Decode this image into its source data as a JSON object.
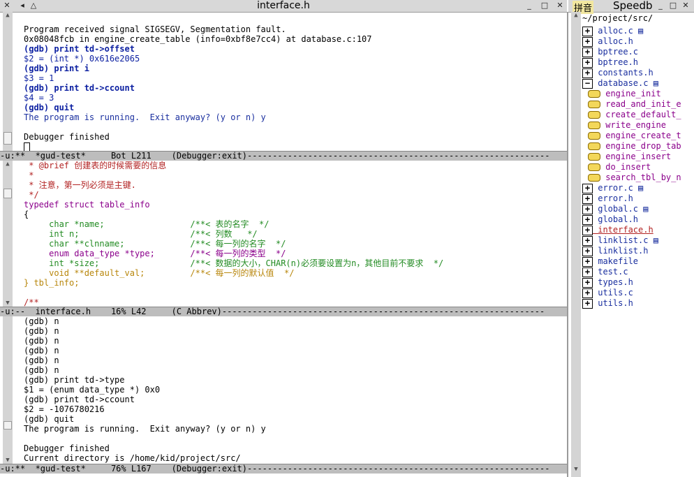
{
  "window": {
    "title": "interface.h"
  },
  "side_window": {
    "title": "Speedb",
    "ime_label": "拼音"
  },
  "gdb_top": {
    "lines": [
      "Program received signal SIGSEGV, Segmentation fault.",
      "0x08048fcb in engine_create_table (info=0xbf8e7cc4) at database.c:107",
      "(gdb) print td->offset",
      "$2 = (int *) 0x616e2065",
      "(gdb) print i",
      "$3 = 1",
      "(gdb) print td->ccount",
      "$4 = 3",
      "(gdb) quit",
      "The program is running.  Exit anyway? (y or n) y",
      "",
      "Debugger finished"
    ],
    "modeline": "-u:**  *gud-test*     Bot L211    (Debugger:exit)------------------------------------------------------------"
  },
  "code_pane": {
    "lines": [
      " * @brief 创建表的时候需要的信息",
      " *",
      " * 注意，第一列必须是主键.",
      " */",
      "typedef struct table_info",
      "{",
      "     char *name;                 /**< 表的名字  */",
      "     int n;                      /**< 列数   */",
      "     char **clnname;             /**< 每一列的名字  */",
      "     enum data_type *type;       /**< 每一列的类型  */",
      "     int *size;                  /**< 数据的大小，CHAR(n)必须要设置为n，其他目前不要求  */",
      "     void **default_val;         /**< 每一列的默认值  */",
      "} tbl_info;",
      "",
      "/**"
    ],
    "modeline": "-u:--  interface.h    16% L42     (C Abbrev)----------------------------------------------------------------"
  },
  "gdb_bottom": {
    "lines": [
      "(gdb) n",
      "(gdb) n",
      "(gdb) n",
      "(gdb) n",
      "(gdb) n",
      "(gdb) n",
      "(gdb) print td->type",
      "$1 = (enum data_type *) 0x0",
      "(gdb) print td->ccount",
      "$2 = -1076780216",
      "(gdb) quit",
      "The program is running.  Exit anyway? (y or n) y",
      "",
      "Debugger finished",
      "Current directory is /home/kid/project/src/"
    ],
    "modeline": "-u:**  *gud-test*     76% L167    (Debugger:exit)------------------------------------------------------------"
  },
  "speedbar": {
    "path": "~/project/src/",
    "items": [
      {
        "kind": "file",
        "label": "alloc.c",
        "obj": true
      },
      {
        "kind": "file",
        "label": "alloc.h",
        "obj": false
      },
      {
        "kind": "file",
        "label": "bptree.c",
        "obj": false
      },
      {
        "kind": "file",
        "label": "bptree.h",
        "obj": false
      },
      {
        "kind": "file",
        "label": "constants.h",
        "obj": false
      },
      {
        "kind": "file-open",
        "label": "database.c",
        "obj": true
      },
      {
        "kind": "tag",
        "label": "engine_init"
      },
      {
        "kind": "tag",
        "label": "read_and_init_e"
      },
      {
        "kind": "tag",
        "label": "create_default_"
      },
      {
        "kind": "tag",
        "label": "write_engine"
      },
      {
        "kind": "tag",
        "label": "engine_create_t"
      },
      {
        "kind": "tag",
        "label": "engine_drop_tab"
      },
      {
        "kind": "tag",
        "label": "engine_insert"
      },
      {
        "kind": "tag",
        "label": "do_insert"
      },
      {
        "kind": "tag",
        "label": "search_tbl_by_n"
      },
      {
        "kind": "file",
        "label": "error.c",
        "obj": true
      },
      {
        "kind": "file",
        "label": "error.h",
        "obj": false
      },
      {
        "kind": "file",
        "label": "global.c",
        "obj": true
      },
      {
        "kind": "file",
        "label": "global.h",
        "obj": false
      },
      {
        "kind": "file-current",
        "label": "interface.h",
        "obj": false
      },
      {
        "kind": "file",
        "label": "linklist.c",
        "obj": true
      },
      {
        "kind": "file",
        "label": "linklist.h",
        "obj": false
      },
      {
        "kind": "file",
        "label": "makefile",
        "obj": false
      },
      {
        "kind": "file",
        "label": "test.c",
        "obj": false
      },
      {
        "kind": "file",
        "label": "types.h",
        "obj": false
      },
      {
        "kind": "file",
        "label": "utils.c",
        "obj": false
      },
      {
        "kind": "file",
        "label": "utils.h",
        "obj": false
      }
    ]
  }
}
